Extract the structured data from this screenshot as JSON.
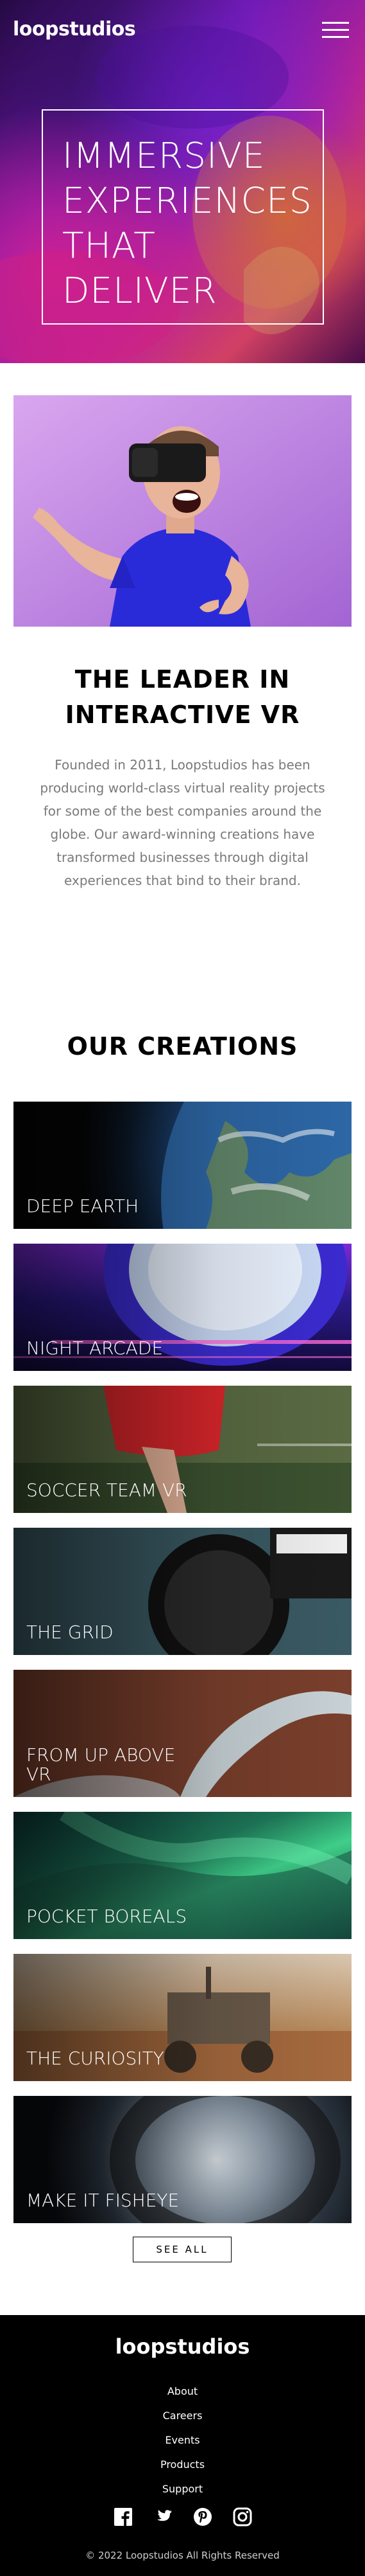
{
  "header": {
    "logo": "loopstudios",
    "menu_icon": "hamburger-menu-icon"
  },
  "hero": {
    "title": "IMMERSIVE\nEXPERIENCES\nTHAT\nDELIVER"
  },
  "intro": {
    "title": "THE LEADER IN INTERACTIVE VR",
    "text": "Founded in 2011, Loopstudios has been producing world-class virtual reality projects for some of the best companies around the globe. Our award-winning creations have transformed businesses through digital experiences that bind to their brand."
  },
  "creations": {
    "title": "OUR CREATIONS",
    "items": [
      {
        "label": "DEEP EARTH"
      },
      {
        "label": "NIGHT ARCADE"
      },
      {
        "label": "SOCCER TEAM VR"
      },
      {
        "label": "THE GRID"
      },
      {
        "label": "FROM UP ABOVE VR"
      },
      {
        "label": "POCKET BOREALS"
      },
      {
        "label": "THE CURIOSITY"
      },
      {
        "label": "MAKE IT FISHEYE"
      }
    ],
    "see_all": "SEE ALL"
  },
  "footer": {
    "logo": "loopstudios",
    "links": [
      "About",
      "Careers",
      "Events",
      "Products",
      "Support"
    ],
    "socials": [
      "facebook-icon",
      "twitter-icon",
      "pinterest-icon",
      "instagram-icon"
    ],
    "copyright": "© 2022 Loopstudios All Rights Reserved"
  }
}
